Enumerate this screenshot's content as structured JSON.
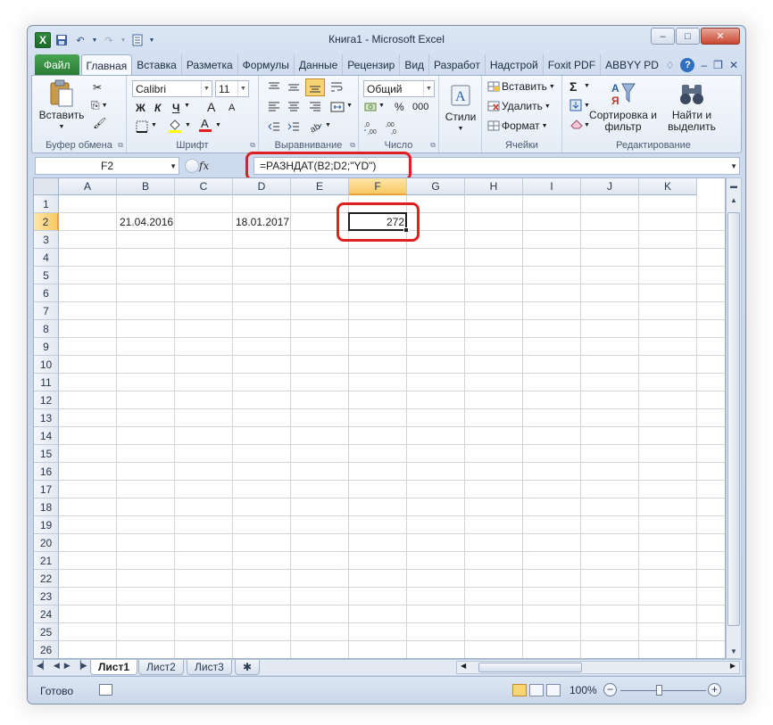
{
  "window": {
    "title": "Книга1 - Microsoft Excel",
    "logo_letter": "X",
    "controls": {
      "minimize": "–",
      "maximize": "□",
      "close": "✕"
    }
  },
  "tabs": [
    {
      "label": "Файл"
    },
    {
      "label": "Главная"
    },
    {
      "label": "Вставка"
    },
    {
      "label": "Разметка"
    },
    {
      "label": "Формулы"
    },
    {
      "label": "Данные"
    },
    {
      "label": "Рецензир"
    },
    {
      "label": "Вид"
    },
    {
      "label": "Разработ"
    },
    {
      "label": "Надстрой"
    },
    {
      "label": "Foxit PDF"
    },
    {
      "label": "ABBYY PD"
    }
  ],
  "ribbon": {
    "clipboard": {
      "label": "Буфер обмена",
      "paste": "Вставить"
    },
    "font": {
      "label": "Шрифт",
      "name": "Calibri",
      "size": "11",
      "bold": "Ж",
      "italic": "К",
      "underline": "Ч",
      "grow": "A",
      "shrink": "A"
    },
    "alignment": {
      "label": "Выравнивание"
    },
    "number": {
      "label": "Число",
      "format": "Общий",
      "percent": "%",
      "thousands": "000"
    },
    "styles": {
      "label": "Стили"
    },
    "cells": {
      "label": "Ячейки",
      "insert": "Вставить",
      "delete": "Удалить",
      "format": "Формат"
    },
    "editing": {
      "label": "Редактирование",
      "sum": "Σ",
      "sort": "Сортировка и фильтр",
      "find": "Найти и выделить"
    }
  },
  "formula_bar": {
    "name_box": "F2",
    "fx": "fx",
    "formula": "=РАЗНДАТ(B2;D2;\"YD\")"
  },
  "columns": [
    "A",
    "B",
    "C",
    "D",
    "E",
    "F",
    "G",
    "H",
    "I",
    "J",
    "K"
  ],
  "rows": [
    "1",
    "2",
    "3",
    "4",
    "5",
    "6",
    "7",
    "8",
    "9",
    "10",
    "11",
    "12",
    "13",
    "14",
    "15",
    "16",
    "17",
    "18",
    "19",
    "20",
    "21",
    "22",
    "23",
    "24",
    "25",
    "26"
  ],
  "cells": {
    "B2": "21.04.2016",
    "D2": "18.01.2017",
    "F2": "272"
  },
  "sheets": [
    {
      "label": "Лист1"
    },
    {
      "label": "Лист2"
    },
    {
      "label": "Лист3"
    }
  ],
  "status": {
    "ready": "Готово",
    "zoom": "100%"
  },
  "colors": {
    "highlight": "#e02020",
    "file_tab": "#2a7b35",
    "selected_header": "#f9c865"
  }
}
